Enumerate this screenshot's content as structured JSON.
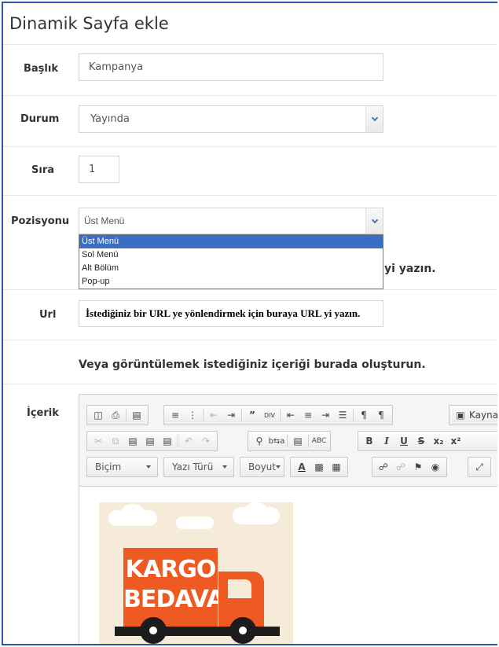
{
  "page": {
    "title": "Dinamik Sayfa ekle"
  },
  "form": {
    "baslik": {
      "label": "Başlık",
      "value": "Kampanya"
    },
    "durum": {
      "label": "Durum",
      "value": "Yayında"
    },
    "sira": {
      "label": "Sıra",
      "value": "1"
    },
    "pozisyon": {
      "label": "Pozisyonu",
      "value": "Üst Menü",
      "options": [
        "Üst Menü",
        "Sol Menü",
        "Alt Bölüm",
        "Pop-up"
      ],
      "selected_index": 0
    },
    "partial_hint": "yi yazın.",
    "url": {
      "label": "Url",
      "value": "İstediğiniz bir URL ye yönlendirmek için buraya URL yi yazın."
    },
    "content_hint": "Veya görüntülemek istediğiniz içeriği burada oluşturun.",
    "icerik": {
      "label": "İçerik"
    }
  },
  "editor": {
    "toolbar_row1": {
      "source_label": "Kaynak",
      "buttons": [
        "preview-icon",
        "print-icon",
        "template-icon",
        "numbered-list-icon",
        "bulleted-list-icon",
        "outdent-icon",
        "indent-icon",
        "blockquote-icon",
        "div-icon",
        "align-left-icon",
        "align-center-icon",
        "align-right-icon",
        "justify-icon",
        "ltr-icon",
        "rtl-icon",
        "source-icon"
      ]
    },
    "toolbar_row2": {
      "buttons": [
        "cut-icon",
        "copy-icon",
        "paste-icon",
        "paste-text-icon",
        "paste-word-icon",
        "undo-icon",
        "redo-icon",
        "find-icon",
        "replace-icon",
        "select-all-icon",
        "spellcheck-icon",
        "bold-icon",
        "italic-icon",
        "underline-icon",
        "strike-icon",
        "subscript-icon",
        "superscript-icon"
      ]
    },
    "toolbar_row3": {
      "format_label": "Biçim",
      "font_label": "Yazı Türü",
      "size_label": "Boyut",
      "buttons": [
        "text-color-icon",
        "bg-color-icon",
        "image-icon",
        "link-icon",
        "unlink-icon",
        "anchor-icon",
        "globe-icon",
        "maximize-icon"
      ]
    },
    "image": {
      "line1": "KARGO",
      "line2": "BEDAVA"
    }
  },
  "colors": {
    "frame_border": "#2b55a6",
    "selected_option": "#3b6dc2",
    "poster_orange": "#ef5a23",
    "poster_bg": "#f6ead8"
  }
}
